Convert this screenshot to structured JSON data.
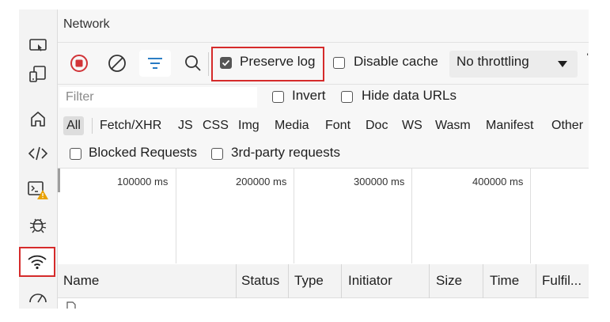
{
  "panel": {
    "title": "Network"
  },
  "sidebar": {
    "items": [
      {
        "icon": "device-emulation-icon"
      },
      {
        "icon": "responsive-icon"
      },
      {
        "icon": "home-icon"
      },
      {
        "icon": "elements-code-icon"
      },
      {
        "icon": "console-warning-icon"
      },
      {
        "icon": "bug-icon"
      },
      {
        "icon": "network-wifi-icon",
        "active": true
      },
      {
        "icon": "performance-icon"
      }
    ]
  },
  "toolbar": {
    "record_icon": "record-icon",
    "clear_icon": "clear-icon",
    "filter_icon": "filter-icon",
    "search_icon": "search-icon",
    "preserve_log_label": "Preserve log",
    "preserve_log_checked": true,
    "disable_cache_label": "Disable cache",
    "disable_cache_checked": false,
    "throttling_value": "No throttling"
  },
  "filter_bar": {
    "placeholder": "Filter",
    "invert_label": "Invert",
    "hide_data_urls_label": "Hide data URLs",
    "types": [
      "All",
      "Fetch/XHR",
      "JS",
      "CSS",
      "Img",
      "Media",
      "Font",
      "Doc",
      "WS",
      "Wasm",
      "Manifest",
      "Other"
    ],
    "selected_type": "All",
    "blocked_requests_label": "Blocked Requests",
    "third_party_label": "3rd-party requests"
  },
  "overview": {
    "ticks": [
      "100000 ms",
      "200000 ms",
      "300000 ms",
      "400000 ms"
    ]
  },
  "table": {
    "columns": [
      "Name",
      "Status",
      "Type",
      "Initiator",
      "Size",
      "Time",
      "Fulfil..."
    ]
  },
  "colors": {
    "highlight_red": "#d52b2b",
    "accent_blue": "#0f6cbd",
    "record_red": "#d13438"
  }
}
